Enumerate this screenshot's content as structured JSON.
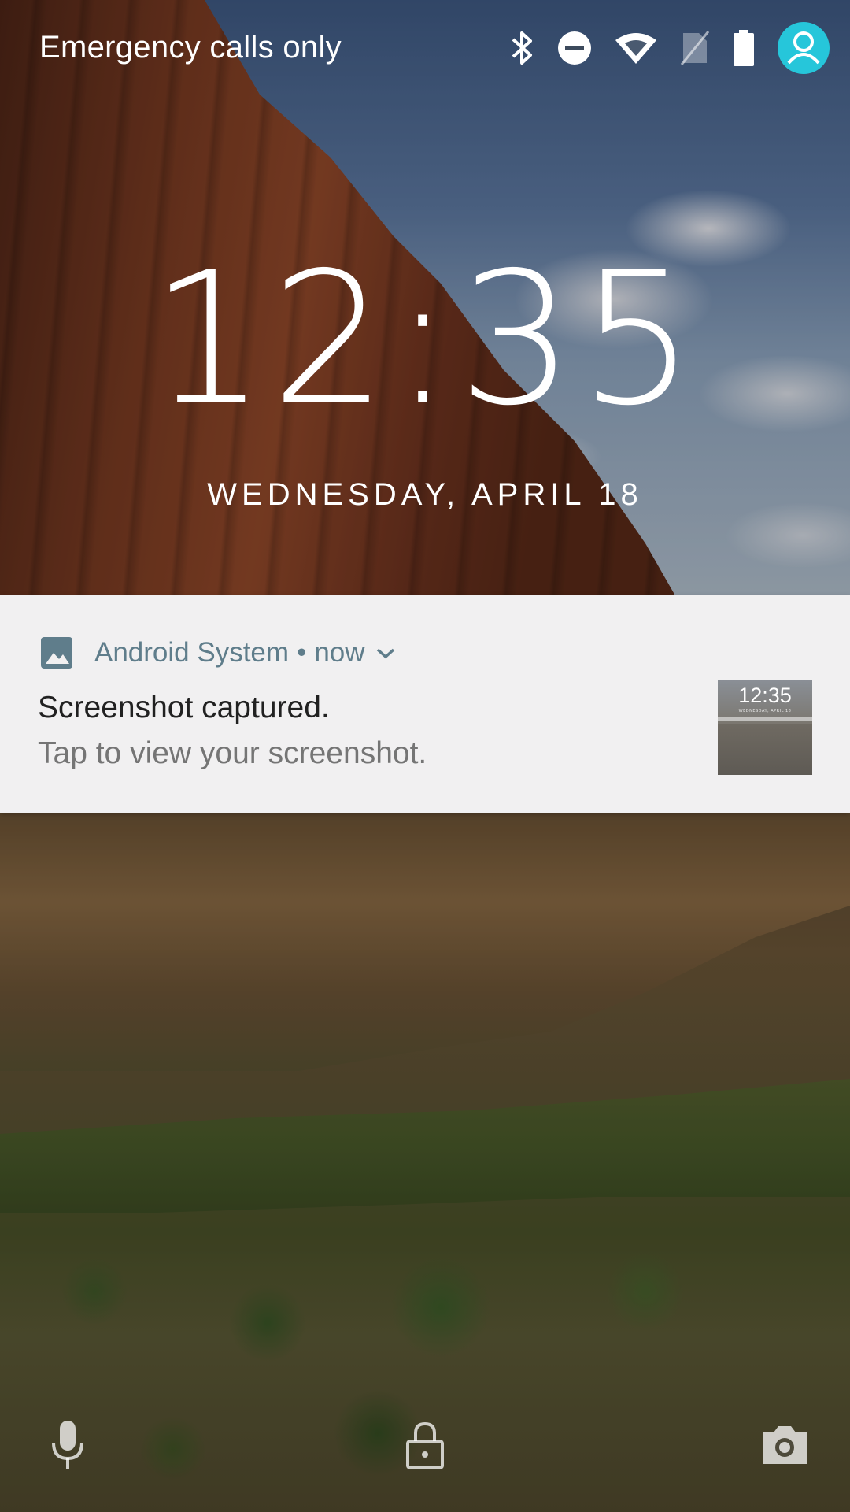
{
  "status_bar": {
    "carrier_text": "Emergency calls only",
    "icons": [
      "bluetooth-icon",
      "do-not-disturb-icon",
      "wifi-icon",
      "no-sim-icon",
      "battery-icon",
      "user-avatar-icon"
    ],
    "avatar_color": "#26c6da"
  },
  "lockscreen": {
    "time": "12:35",
    "date": "WEDNESDAY, APRIL 18"
  },
  "notification": {
    "app_icon": "image-icon",
    "app_name": "Android System",
    "separator": "•",
    "time": "now",
    "expand_icon": "chevron-down-icon",
    "title": "Screenshot captured.",
    "text": "Tap to view your screenshot.",
    "thumbnail": {
      "time": "12:35",
      "date": "WEDNESDAY, APRIL 18"
    },
    "accent_color": "#5f7d8b"
  },
  "bottom_actions": {
    "left": "microphone-icon",
    "center": "lock-icon",
    "right": "camera-icon"
  }
}
